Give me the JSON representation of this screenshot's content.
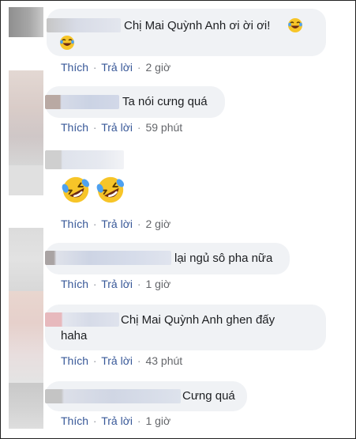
{
  "comments": [
    {
      "text": "Chị Mai Quỳnh Anh ơi ời ơi!",
      "like": "Thích",
      "reply": "Trả lời",
      "time": "2 giờ"
    },
    {
      "text": "Ta nói cưng quá",
      "like": "Thích",
      "reply": "Trả lời",
      "time": "59 phút"
    },
    {
      "text": "",
      "like": "Thích",
      "reply": "Trả lời",
      "time": "2 giờ",
      "emojis": [
        "rofl-emoji",
        "rofl-emoji"
      ]
    },
    {
      "text": "lại ngủ sô pha nữa",
      "like": "Thích",
      "reply": "Trả lời",
      "time": "1 giờ"
    },
    {
      "text_line1": "Chị Mai Quỳnh Anh ghen đấy",
      "text_line2": "haha",
      "like": "Thích",
      "reply": "Trả lời",
      "time": "43 phút"
    },
    {
      "text": "Cưng quá",
      "like": "Thích",
      "reply": "Trả lời",
      "time": "1 giờ"
    }
  ],
  "separator": "·",
  "colors": {
    "bubble": "#f0f2f5",
    "link": "#385898",
    "meta": "#65676b",
    "emoji_face": "#f7c528",
    "emoji_tear": "#4ea1f0"
  }
}
